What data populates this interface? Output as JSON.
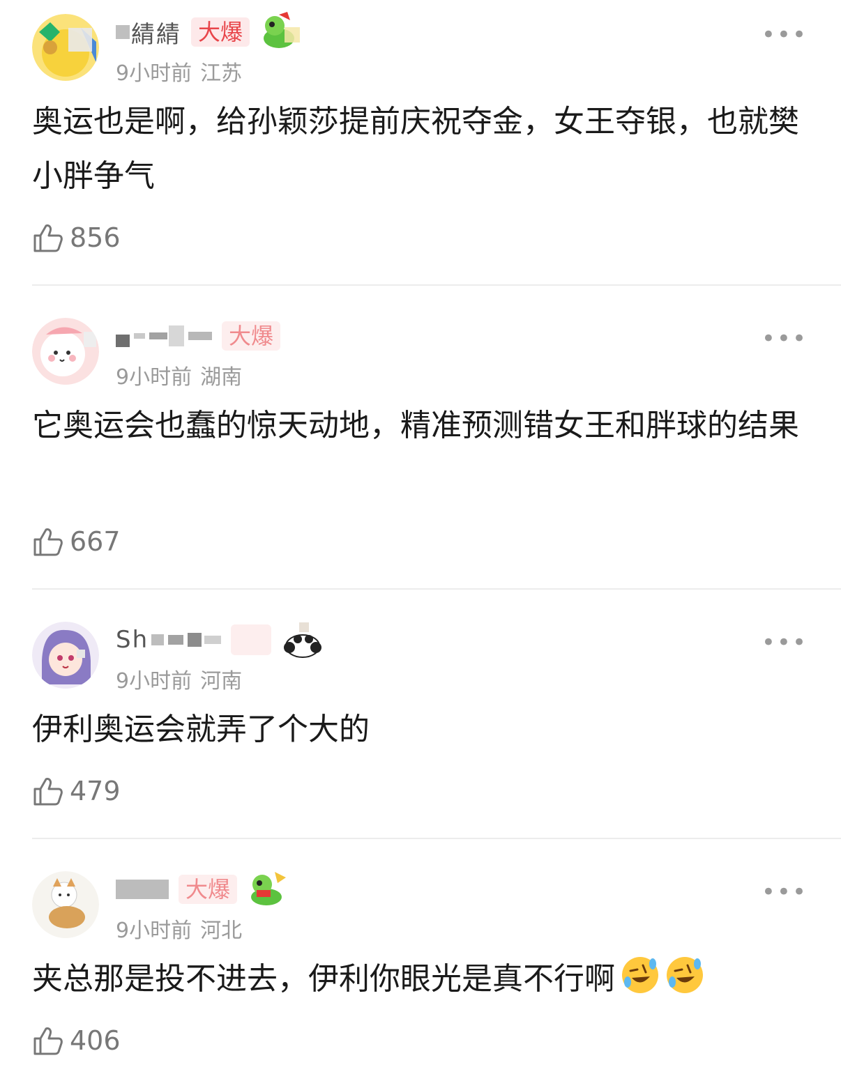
{
  "comments": [
    {
      "username_visible": "綪綪",
      "badge": "大爆",
      "time": "9小时前",
      "region": "江苏",
      "text": "奥运也是啊，给孙颖莎提前庆祝夺金，女王夺银，也就樊小胖争气",
      "likes": "856",
      "more": "•••"
    },
    {
      "username_visible": "",
      "badge": "大爆",
      "time": "9小时前",
      "region": "湖南",
      "text": "它奥运会也蠢的惊天动地，精准预测错女王和胖球的结果",
      "likes": "667",
      "more": "•••"
    },
    {
      "username_visible": "Sh",
      "badge": "",
      "time": "9小时前",
      "region": "河南",
      "text": "伊利奥运会就弄了个大的",
      "likes": "479",
      "more": "•••"
    },
    {
      "username_visible": "",
      "badge": "大爆",
      "time": "9小时前",
      "region": "河北",
      "text": "夹总那是投不进去，伊利你眼光是真不行啊",
      "text_emoji": "rolling-on-floor-laughing-icon",
      "likes": "406",
      "more": "•••"
    }
  ]
}
